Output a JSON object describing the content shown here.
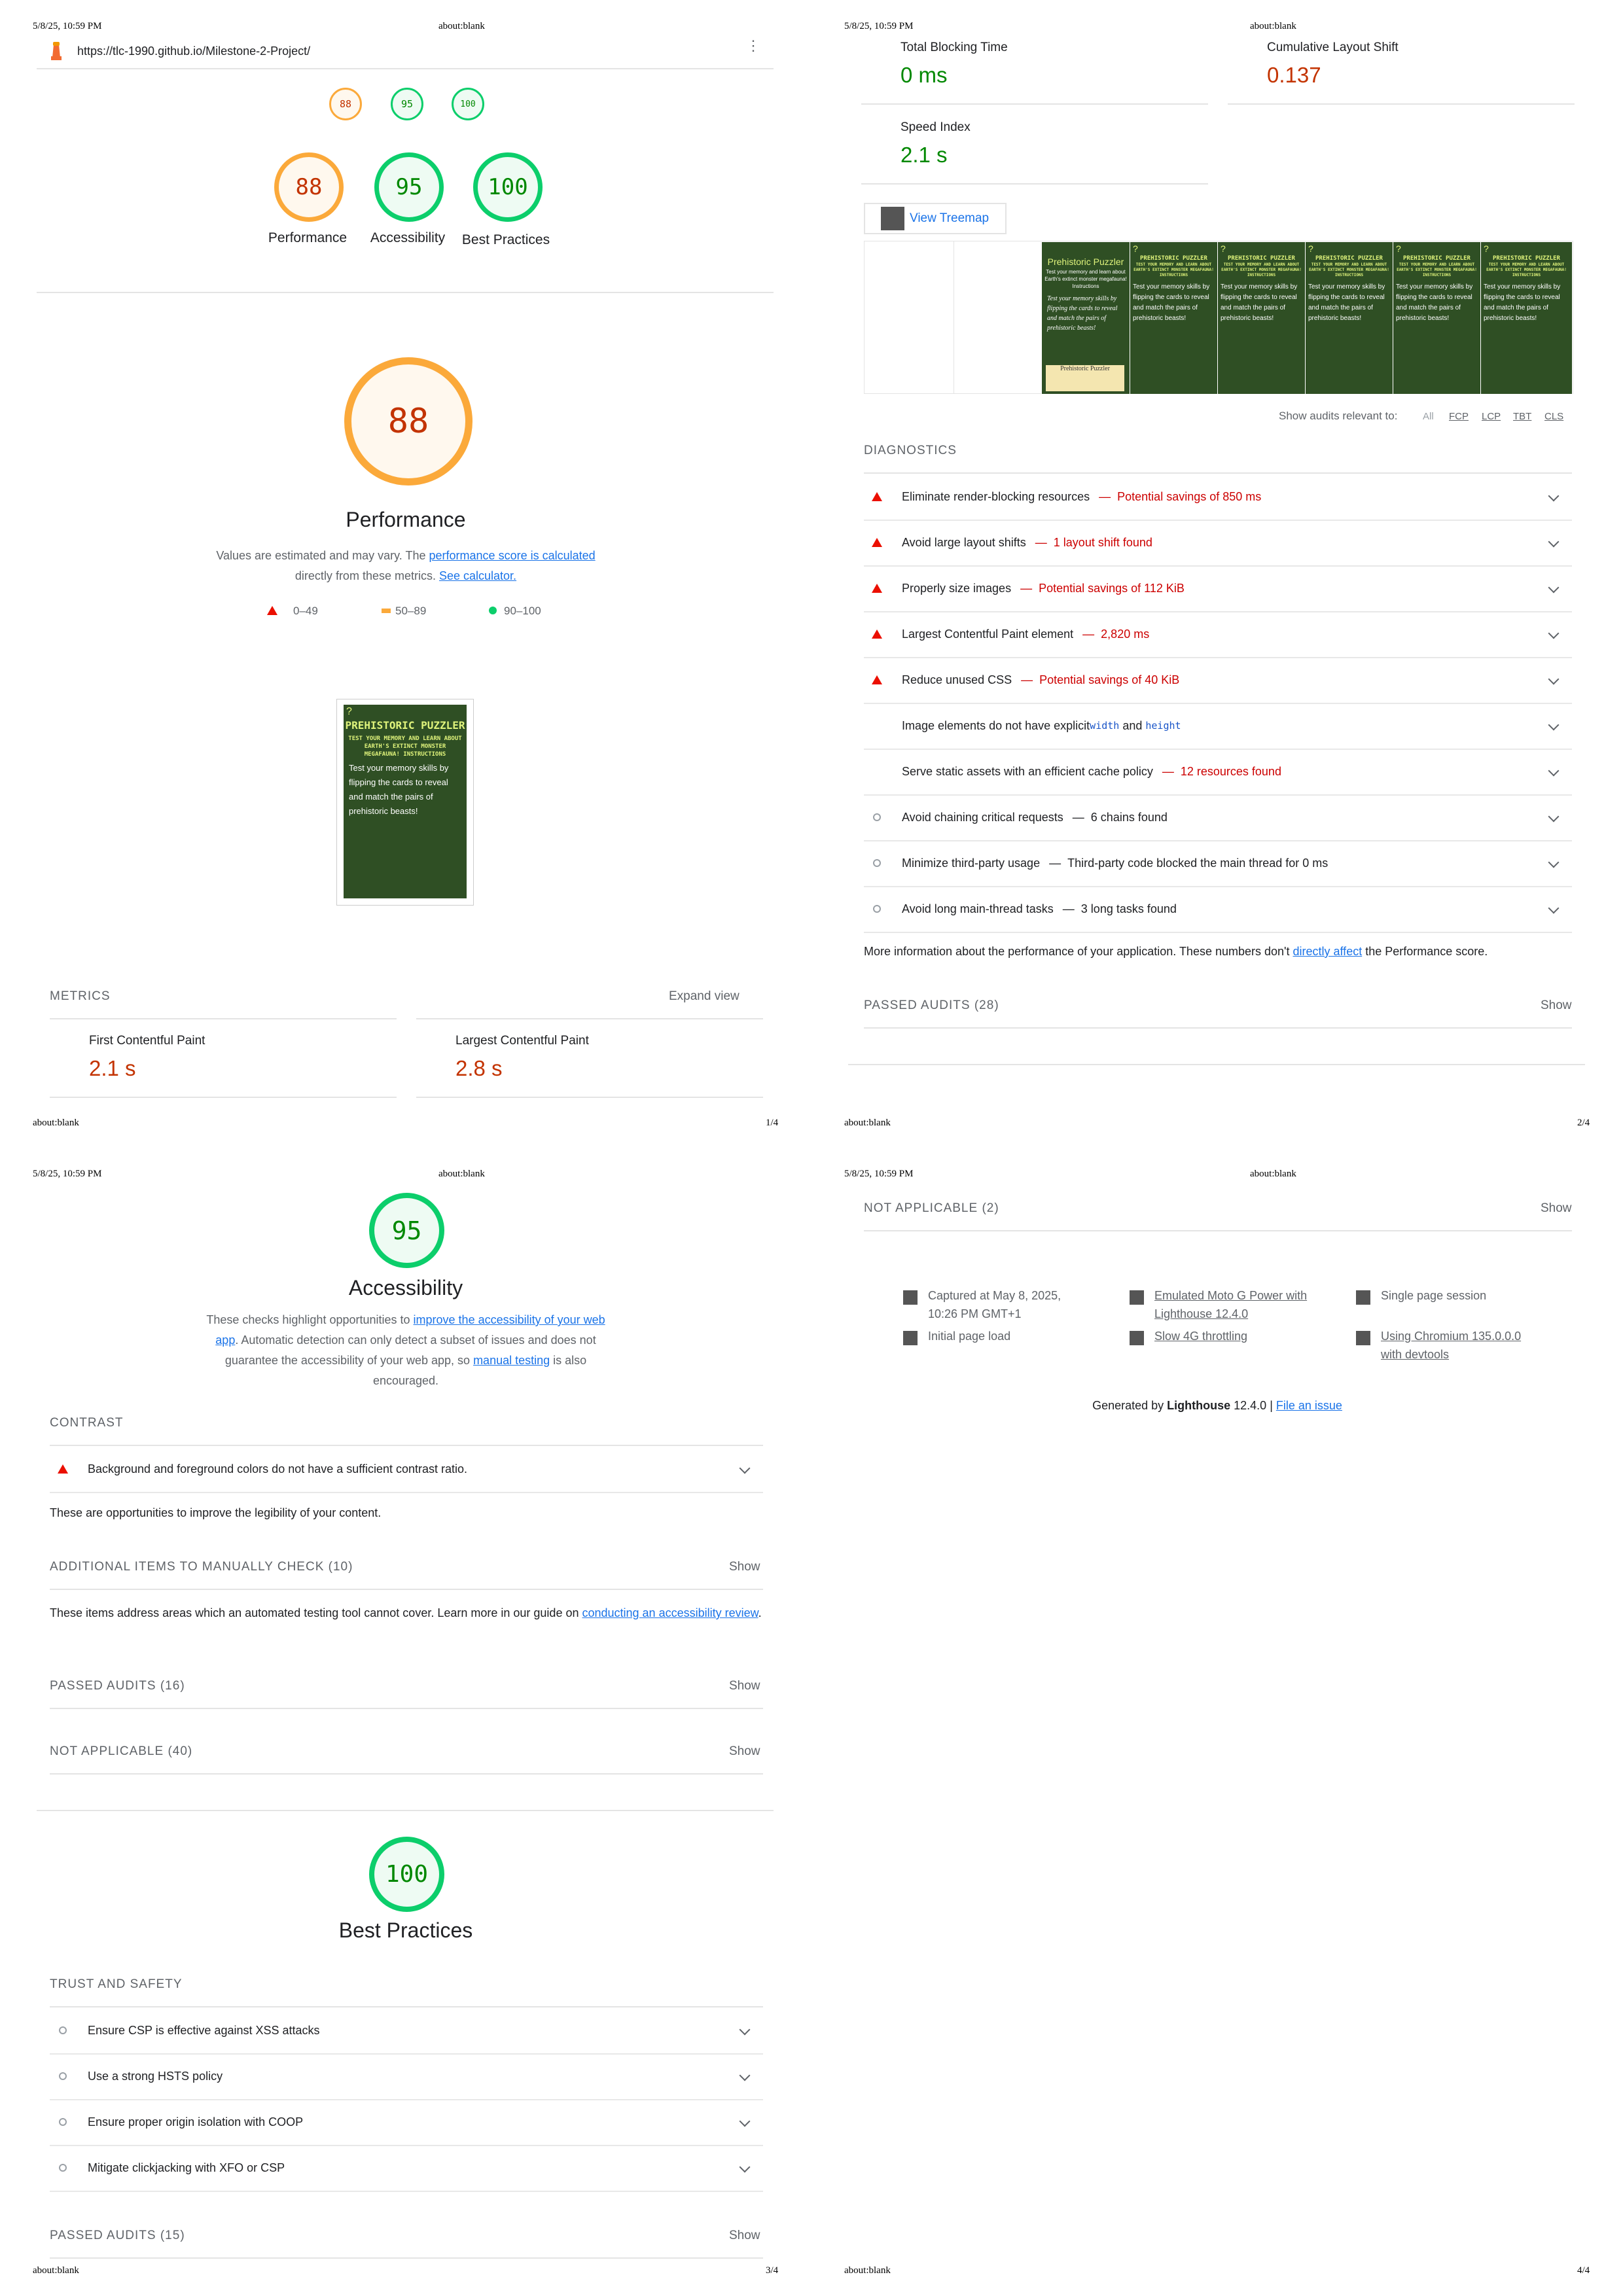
{
  "print": {
    "timestamp": "5/8/25, 10:59 PM",
    "title": "about:blank",
    "footer_left": "about:blank",
    "page_numbers": [
      "1/4",
      "2/4",
      "3/4",
      "4/4"
    ]
  },
  "header": {
    "url": "https://tlc-1990.github.io/Milestone-2-Project/",
    "mini_scores": [
      "88",
      "95",
      "100"
    ]
  },
  "categories": [
    {
      "label": "Performance",
      "score": "88"
    },
    {
      "label": "Accessibility",
      "score": "95"
    },
    {
      "label": "Best Practices",
      "score": "100"
    }
  ],
  "performance": {
    "score": "88",
    "title": "Performance",
    "desc_pre": "Values are estimated and may vary. The ",
    "desc_link1": "performance score is calculated",
    "desc_mid": " directly from these metrics. ",
    "desc_link2": "See calculator.",
    "legend": [
      "0–49",
      "50–89",
      "90–100"
    ],
    "screenshot": {
      "title": "PREHISTORIC PUZZLER",
      "subtitle": "TEST YOUR MEMORY AND LEARN ABOUT EARTH'S EXTINCT MONSTER MEGAFAUNA! INSTRUCTIONS",
      "body": "Test your memory skills by flipping the cards to reveal and match the pairs of prehistoric beasts!"
    },
    "metrics_title": "METRICS",
    "expand_view": "Expand view",
    "metrics": [
      {
        "label": "First Contentful Paint",
        "value": "2.1 s"
      },
      {
        "label": "Largest Contentful Paint",
        "value": "2.8 s"
      },
      {
        "label": "Total Blocking Time",
        "value": "0 ms"
      },
      {
        "label": "Cumulative Layout Shift",
        "value": "0.137"
      },
      {
        "label": "Speed Index",
        "value": "2.1 s"
      }
    ],
    "view_treemap": "View Treemap",
    "filmstrip_first": {
      "title": "Prehistoric Puzzler",
      "sub": "Test your memory and learn about Earth's extinct monster megafauna! Instructions",
      "body": "Test your memory skills by flipping the cards to reveal and match the pairs of prehistoric beasts!",
      "footer": "Prehistoric Puzzler"
    },
    "show_audits_label": "Show audits relevant to:",
    "filters": [
      "All",
      "FCP",
      "LCP",
      "TBT",
      "CLS"
    ],
    "diagnostics_title": "DIAGNOSTICS",
    "diagnostics": [
      {
        "title": "Eliminate render-blocking resources",
        "detail": "Potential savings of 850 ms",
        "kind": "fail"
      },
      {
        "title": "Avoid large layout shifts",
        "detail": "1 layout shift found",
        "kind": "fail"
      },
      {
        "title": "Properly size images",
        "detail": "Potential savings of 112 KiB",
        "kind": "fail"
      },
      {
        "title": "Largest Contentful Paint element",
        "detail": "2,820 ms",
        "kind": "fail"
      },
      {
        "title": "Reduce unused CSS",
        "detail": "Potential savings of 40 KiB",
        "kind": "fail"
      },
      {
        "title_pre": "Image elements do not have explicit ",
        "code1": "width",
        "title_and": " and ",
        "code2": "height",
        "kind": "none"
      },
      {
        "title": "Serve static assets with an efficient cache policy",
        "detail": "12 resources found",
        "kind": "none-red"
      },
      {
        "title": "Avoid chaining critical requests",
        "detail": "6 chains found",
        "kind": "info"
      },
      {
        "title": "Minimize third-party usage",
        "detail": "Third-party code blocked the main thread for 0 ms",
        "kind": "info"
      },
      {
        "title": "Avoid long main-thread tasks",
        "detail": "3 long tasks found",
        "kind": "info"
      }
    ],
    "more_info_pre": "More information about the performance of your application. These numbers don't ",
    "more_info_link": "directly affect",
    "more_info_post": " the Performance score.",
    "passed": "PASSED AUDITS (28)",
    "show": "Show"
  },
  "accessibility": {
    "score": "95",
    "title": "Accessibility",
    "desc_pre": "These checks highlight opportunities to ",
    "desc_link1": "improve the accessibility of your web app",
    "desc_mid": ". Automatic detection can only detect a subset of issues and does not guarantee the accessibility of your web app, so ",
    "desc_link2": "manual testing",
    "desc_post": " is also encouraged.",
    "contrast_title": "CONTRAST",
    "contrast_audit": "Background and foreground colors do not have a sufficient contrast ratio.",
    "contrast_note": "These are opportunities to improve the legibility of your content.",
    "manual_title": "ADDITIONAL ITEMS TO MANUALLY CHECK (10)",
    "manual_note_pre": "These items address areas which an automated testing tool cannot cover. Learn more in our guide on ",
    "manual_note_link": "conducting an accessibility review",
    "manual_note_post": ".",
    "passed": "PASSED AUDITS (16)",
    "not_applicable": "NOT APPLICABLE (40)",
    "show": "Show"
  },
  "best_practices": {
    "score": "100",
    "title": "Best Practices",
    "trust_title": "TRUST AND SAFETY",
    "audits": [
      "Ensure CSP is effective against XSS attacks",
      "Use a strong HSTS policy",
      "Ensure proper origin isolation with COOP",
      "Mitigate clickjacking with XFO or CSP"
    ],
    "passed": "PASSED AUDITS (15)",
    "not_applicable": "NOT APPLICABLE (2)",
    "show": "Show"
  },
  "runtime": {
    "items": [
      "Captured at May 8, 2025, 10:26 PM GMT+1",
      "Initial page load",
      "Emulated Moto G Power with Lighthouse 12.4.0",
      "Slow 4G throttling",
      "Single page session",
      "Using Chromium 135.0.0.0 with devtools"
    ],
    "generated_pre": "Generated by ",
    "generated_brand": "Lighthouse",
    "generated_version": " 12.4.0 | ",
    "file_issue": "File an issue"
  },
  "colors": {
    "fail": "#c33300",
    "pass": "#008800",
    "average": "#fba93a",
    "good": "#0cce6b",
    "link": "#1a73e8"
  }
}
